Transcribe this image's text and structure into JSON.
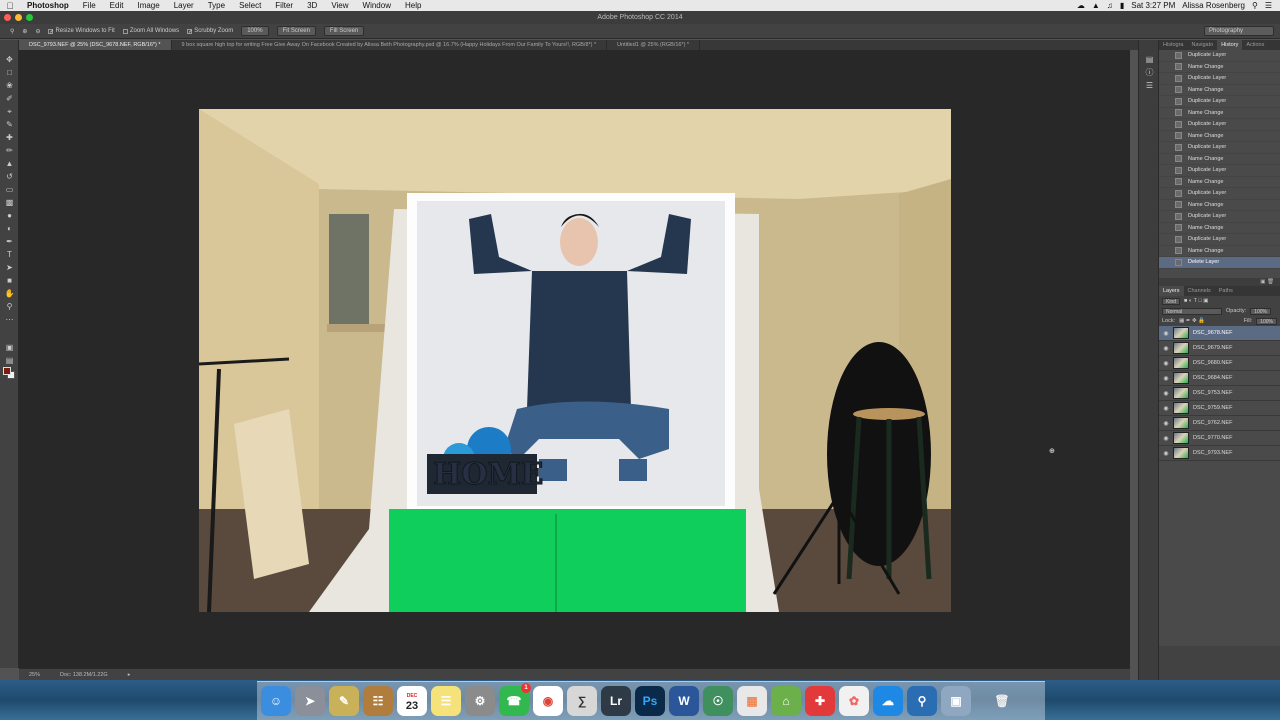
{
  "menubar": {
    "app_name": "Photoshop",
    "items": [
      "File",
      "Edit",
      "Image",
      "Layer",
      "Type",
      "Select",
      "Filter",
      "3D",
      "View",
      "Window",
      "Help"
    ],
    "clock": "Sat 3:27 PM",
    "user": "Alissa Rosenberg"
  },
  "titlebar": {
    "title": "Adobe Photoshop CC 2014"
  },
  "options": {
    "resize_windows": "Resize Windows to Fit",
    "zoom_all": "Zoom All Windows",
    "scrubby_zoom": "Scrubby Zoom",
    "zoom_100": "100%",
    "fit_screen": "Fit Screen",
    "fill_screen": "Fill Screen",
    "workspace": "Photography"
  },
  "tabs": [
    "DSC_9793.NEF @ 25% (DSC_9678.NEF, RGB/16*) *",
    "9 box square high top for writing Free Give Away On Facebook Created by Alissa Beth Photography.psd @ 16.7% (Happy Holidays From Our Family To Yours!!, RGB/8*) *",
    "Untitled1 @ 25% (RGB/16*) *"
  ],
  "photo": {
    "sign_text": "HOME"
  },
  "status": {
    "zoom": "25%",
    "doc": "Doc: 138.2M/1.22G"
  },
  "panel_tabs": {
    "navigator": "Histogra",
    "nav": "Navigato",
    "history": "History",
    "actions": "Actions"
  },
  "history": [
    "Duplicate Layer",
    "Name Change",
    "Duplicate Layer",
    "Name Change",
    "Duplicate Layer",
    "Name Change",
    "Duplicate Layer",
    "Name Change",
    "Duplicate Layer",
    "Name Change",
    "Duplicate Layer",
    "Name Change",
    "Duplicate Layer",
    "Name Change",
    "Duplicate Layer",
    "Name Change",
    "Duplicate Layer",
    "Name Change",
    "Delete Layer"
  ],
  "layers_panel": {
    "tabs": [
      "Layers",
      "Channels",
      "Paths"
    ],
    "kind": "Kind",
    "blend_mode": "Normal",
    "opacity_label": "Opacity:",
    "opacity": "100%",
    "lock_label": "Lock:",
    "fill_label": "Fill:",
    "fill": "100%",
    "layers": [
      "DSC_9678.NEF",
      "DSC_9679.NEF",
      "DSC_9680.NEF",
      "DSC_9684.NEF",
      "DSC_9753.NEF",
      "DSC_9759.NEF",
      "DSC_9762.NEF",
      "DSC_9770.NEF",
      "DSC_9793.NEF"
    ]
  },
  "dock": {
    "calendar_day": "23",
    "calendar_month": "DEC",
    "facetime_badge": "1",
    "lr_label": "Lr",
    "ps_label": "Ps",
    "word_label": "W"
  },
  "colors": {
    "foreground_swatch": "#7b1c10",
    "selection": "#5b6b84",
    "green_screen": "#0fce5c"
  }
}
